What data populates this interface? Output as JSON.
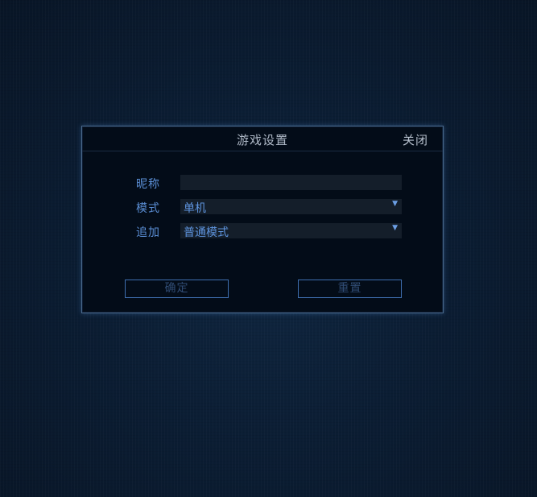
{
  "dialog": {
    "title": "游戏设置",
    "close_label": "关闭",
    "fields": [
      {
        "label": "昵称",
        "value": ""
      },
      {
        "label": "模式",
        "value": "单机"
      },
      {
        "label": "追加",
        "value": "普通模式"
      }
    ],
    "buttons": {
      "confirm_label": "确定",
      "reset_label": "重置"
    }
  },
  "colors": {
    "background": "#0b1d33",
    "dialog_bg": "#030c18",
    "accent": "#5b8fd6",
    "button_border": "#3f6fb0"
  }
}
